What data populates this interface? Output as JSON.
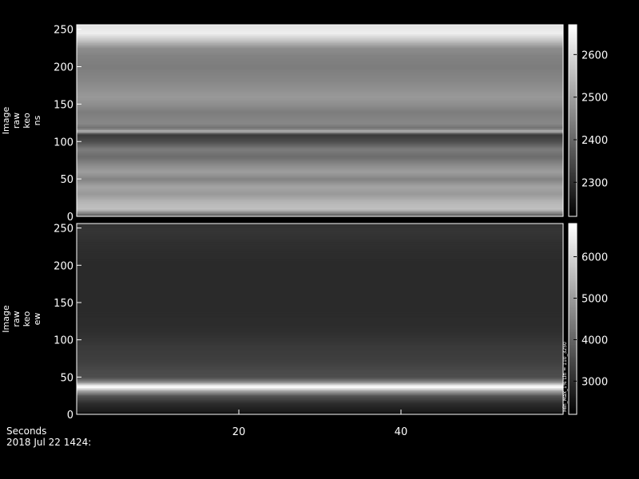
{
  "chart_data": [
    {
      "type": "heatmap",
      "ylabel_lines": [
        "Image",
        "raw",
        "keo",
        "ns"
      ],
      "ylim": [
        0,
        256
      ],
      "yticks": [
        0,
        50,
        100,
        150,
        200,
        250
      ],
      "xlim": [
        0,
        60
      ],
      "colorbar": {
        "range": [
          2220,
          2670
        ],
        "ticks": [
          2300,
          2400,
          2500,
          2600
        ]
      },
      "rows": {
        "rows_from_bottom": [
          0,
          10,
          20,
          30,
          40,
          50,
          60,
          70,
          80,
          90,
          100,
          105,
          110,
          114,
          118,
          125,
          140,
          150,
          160,
          180,
          200,
          215,
          225,
          235,
          245,
          256
        ],
        "values": [
          2350,
          2560,
          2540,
          2490,
          2510,
          2450,
          2500,
          2460,
          2410,
          2440,
          2360,
          2340,
          2320,
          2550,
          2420,
          2460,
          2440,
          2470,
          2490,
          2460,
          2440,
          2450,
          2470,
          2560,
          2640,
          2620
        ]
      }
    },
    {
      "type": "heatmap",
      "ylabel_lines": [
        "Image",
        "raw",
        "keo",
        "ew"
      ],
      "ylim": [
        0,
        256
      ],
      "yticks": [
        0,
        50,
        100,
        150,
        200,
        250
      ],
      "xlim": [
        0,
        60
      ],
      "xticks": [
        20,
        40
      ],
      "xlabel": "Seconds",
      "colorbar": {
        "range": [
          2200,
          6800
        ],
        "ticks": [
          3000,
          4000,
          5000,
          6000
        ],
        "side_label": "Min_Max_1% Lin ≈ 110_3250"
      },
      "rows": {
        "rows_from_bottom": [
          0,
          5,
          15,
          25,
          32,
          36,
          38,
          40,
          44,
          50,
          60,
          70,
          80,
          90,
          100,
          110,
          120,
          150,
          200,
          230,
          245,
          256
        ],
        "values": [
          2300,
          2700,
          3000,
          3700,
          5200,
          6600,
          6800,
          6200,
          4600,
          3600,
          3500,
          3350,
          3300,
          3250,
          3150,
          3050,
          3000,
          2950,
          2950,
          3050,
          3150,
          3100
        ]
      }
    }
  ],
  "footer": {
    "time_label": "Seconds",
    "date_label": "2018 Jul 22 1424:"
  }
}
